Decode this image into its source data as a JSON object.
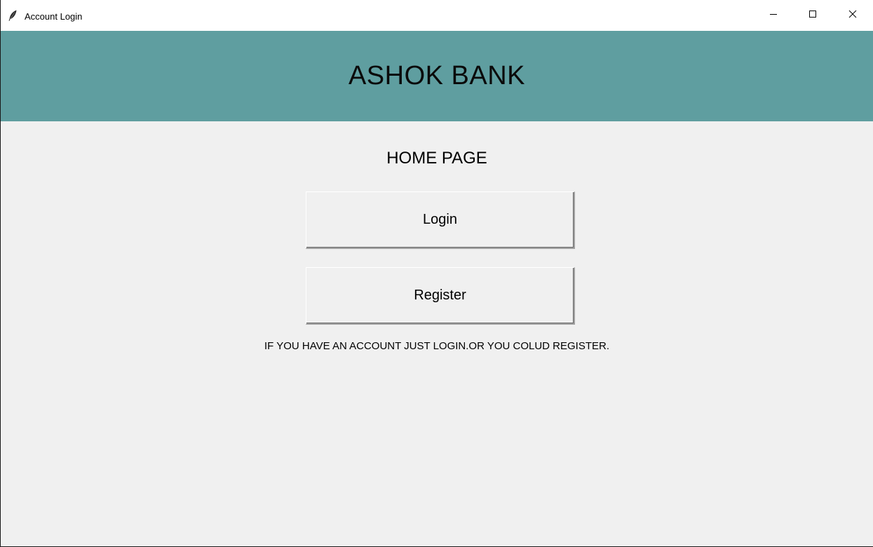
{
  "window": {
    "title": "Account Login",
    "icon": "feather-icon",
    "controls": {
      "minimize_icon": "minimize-icon",
      "maximize_icon": "maximize-icon",
      "close_icon": "close-icon"
    }
  },
  "header": {
    "bank_name": "ASHOK BANK",
    "background_color": "#5f9ea0"
  },
  "main": {
    "heading": "HOME PAGE",
    "login_label": "Login",
    "register_label": "Register",
    "info": "IF YOU HAVE AN ACCOUNT JUST LOGIN.OR YOU COLUD REGISTER."
  }
}
